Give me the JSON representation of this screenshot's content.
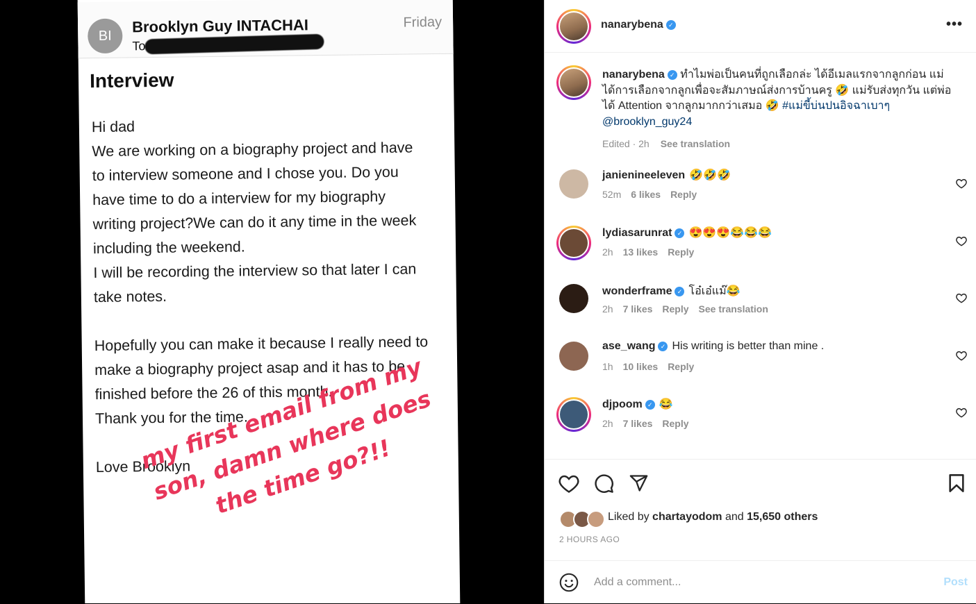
{
  "email": {
    "avatar_initials": "BI",
    "from": "Brooklyn Guy INTACHAI",
    "to_label": "To:",
    "date": "Friday",
    "subject": "Interview",
    "body_lines": [
      "Hi dad",
      "We are working on a biography project and have",
      "to interview someone and I chose you. Do you",
      "have time to do a interview for my biography",
      "writing project?We can do it any time in the week",
      "including the weekend.",
      "I will be recording the interview so that later I can",
      "take notes.",
      "",
      "Hopefully you can make it because I really need to",
      "make a biography project asap and it has to be",
      "finished before the 26 of this month.",
      "Thank you for the time.",
      "",
      "Love Brooklyn"
    ],
    "overlay_text": "my first email from my son, damn where does the time go?!!"
  },
  "post": {
    "author": "nanarybena",
    "more_icon": "more-horizontal-icon",
    "caption": {
      "text": "ทำไมพ่อเป็นคนที่ถูกเลือกล่ะ ได้อีเมลแรกจากลูกก่อน แม่ ได้การเลือกจากลูกเพื่อจะสัมภาษณ์ส่งการบ้านครู 🤣 แม่รับส่งทุกวัน แต่พ่อได้ Attention จากลูกมากกว่าเสมอ 🤣",
      "hashtag": "#แม่ขี้บ่นปนอิจฉาเบาๆ",
      "mention": "@brooklyn_guy24",
      "edited": "Edited · 2h",
      "see_translation": "See translation"
    },
    "comments": [
      {
        "user": "janienineeleven",
        "verified": false,
        "text": "🤣🤣🤣",
        "time": "52m",
        "likes": "6 likes",
        "reply": "Reply",
        "extra": ""
      },
      {
        "user": "lydiasarunrat",
        "verified": true,
        "text": "😍😍😍😂😂😂",
        "time": "2h",
        "likes": "13 likes",
        "reply": "Reply",
        "extra": ""
      },
      {
        "user": "wonderframe",
        "verified": true,
        "text": "โอ๋เอ๋แม๊😂",
        "time": "2h",
        "likes": "7 likes",
        "reply": "Reply",
        "extra": "See translation"
      },
      {
        "user": "ase_wang",
        "verified": true,
        "text": "His writing is better than mine .",
        "time": "1h",
        "likes": "10 likes",
        "reply": "Reply",
        "extra": ""
      },
      {
        "user": "djpoom",
        "verified": true,
        "text": "😂",
        "time": "2h",
        "likes": "7 likes",
        "reply": "Reply",
        "extra": ""
      }
    ],
    "likes": {
      "prefix": "Liked by",
      "user": "chartayodom",
      "middle": "and",
      "others": "15,650 others"
    },
    "time_ago": "2 HOURS AGO",
    "add_comment_placeholder": "Add a comment...",
    "post_button": "Post",
    "colors": {
      "link": "#00376b",
      "verified": "#3897f0",
      "post_disabled": "#b2dffc"
    }
  }
}
